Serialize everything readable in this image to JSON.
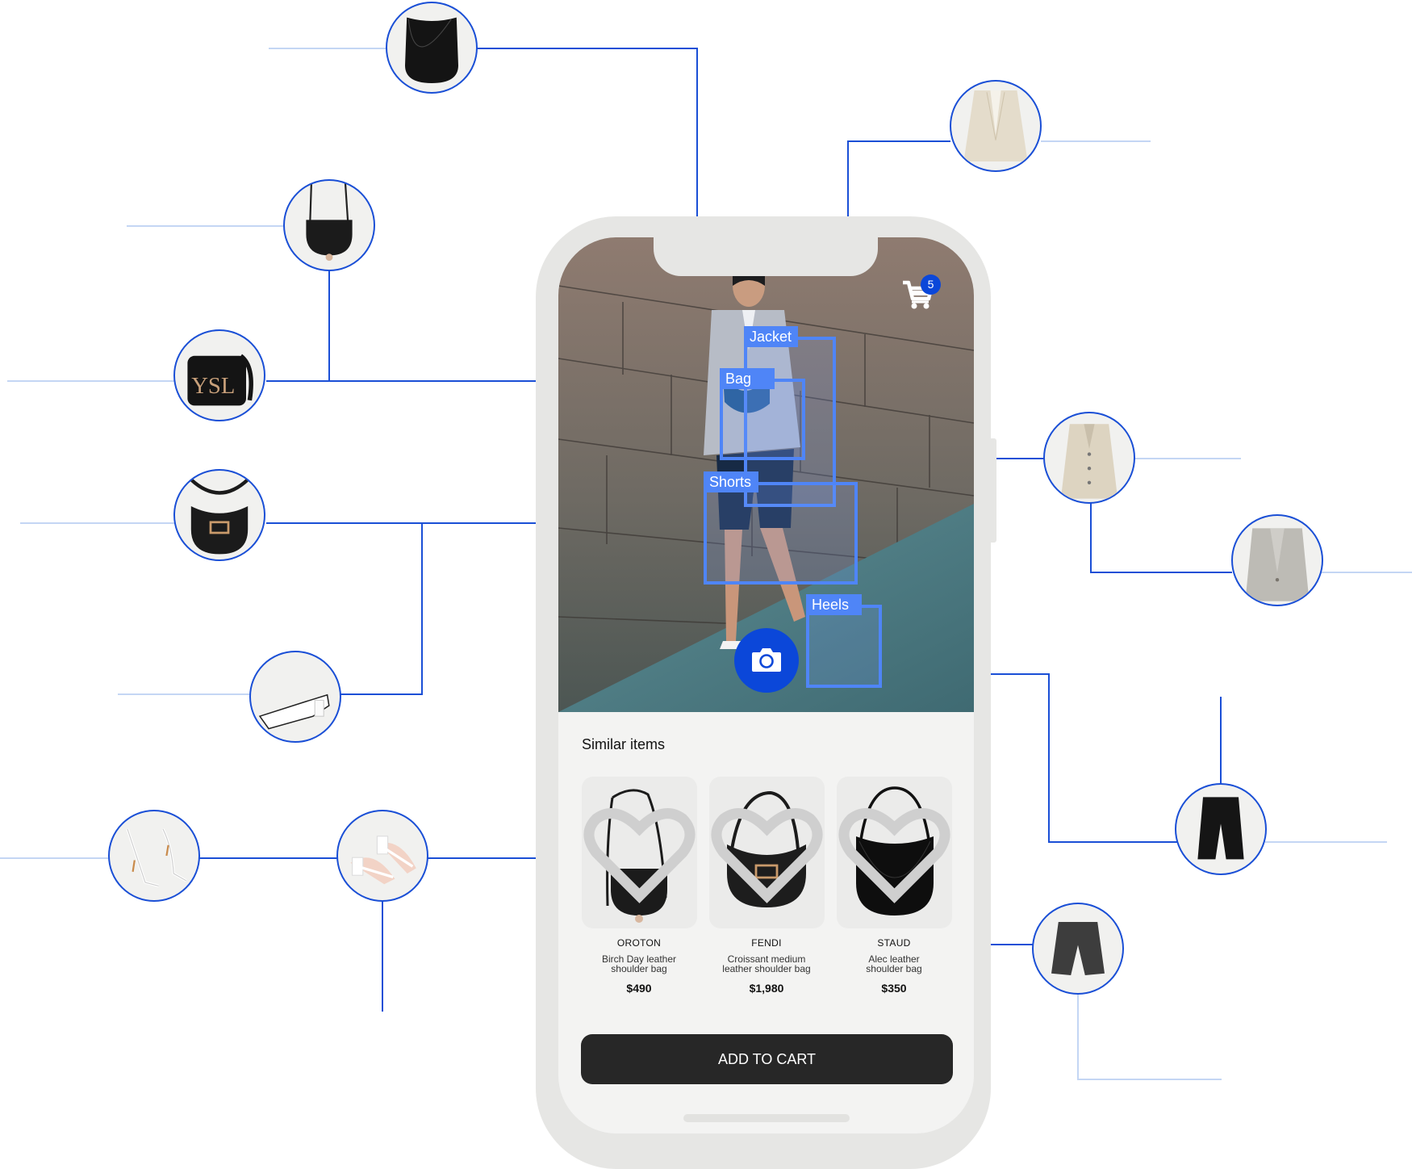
{
  "colors": {
    "accent": "#0b47d9",
    "connector": "#1a4fd6",
    "connector_light": "#c4d6f4",
    "detection": "#4f85f7",
    "button_dark": "#272727"
  },
  "header": {
    "cart_icon": "shopping-cart-icon",
    "cart_count": "5"
  },
  "detections": [
    {
      "label": "Jacket"
    },
    {
      "label": "Bag"
    },
    {
      "label": "Shorts"
    },
    {
      "label": "Heels"
    }
  ],
  "camera_button": {
    "icon": "camera-icon"
  },
  "similar": {
    "title": "Similar items",
    "items": [
      {
        "brand": "OROTON",
        "name_line1": "Birch Day leather",
        "name_line2": "shoulder bag",
        "price": "$490",
        "icon": "heart-icon"
      },
      {
        "brand": "FENDI",
        "name_line1": "Croissant medium",
        "name_line2": "leather shoulder bag",
        "price": "$1,980",
        "icon": "heart-icon"
      },
      {
        "brand": "STAUD",
        "name_line1": "Alec leather",
        "name_line2": "shoulder bag",
        "price": "$350",
        "icon": "heart-icon"
      }
    ]
  },
  "add_to_cart_label": "ADD TO CART",
  "related_products": {
    "left": [
      "black hobo bag",
      "black saddle crossbody bag",
      "black croc YSL crossbody bag",
      "black Fendi croissant bag",
      "white mule sandal",
      "white strappy heeled sandal",
      "white block-heel strappy sandal"
    ],
    "right": [
      "cream double-breasted blazer",
      "cream single-breasted jacket",
      "grey oversized blazer",
      "black denim bermuda shorts",
      "grey washed denim shorts"
    ]
  }
}
